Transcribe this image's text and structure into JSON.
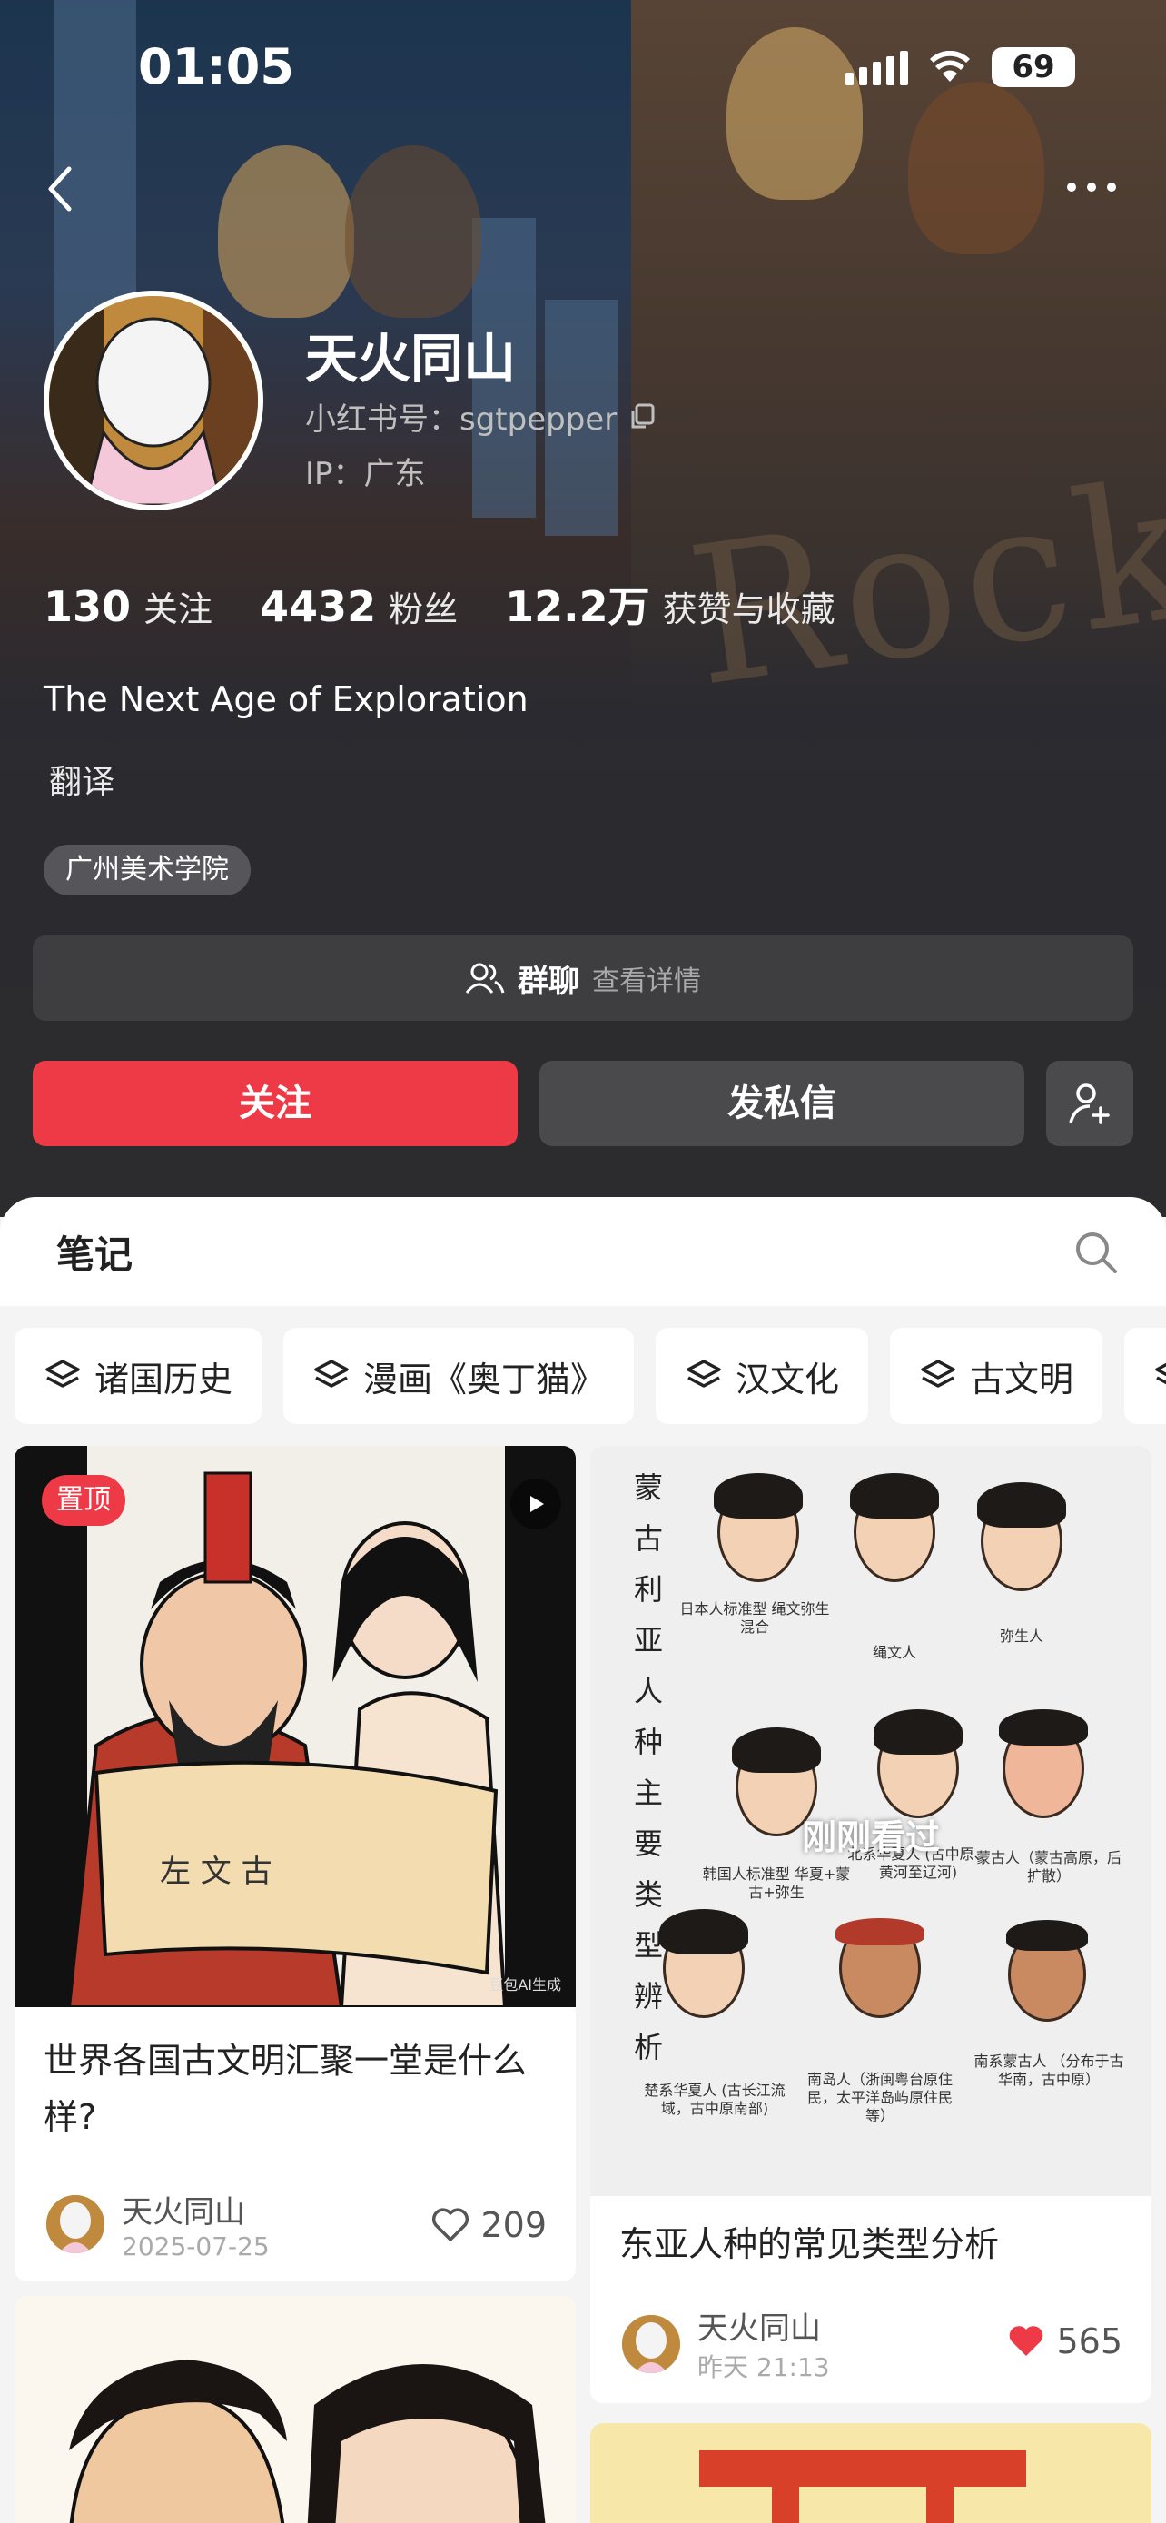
{
  "status_bar": {
    "time": "01:05",
    "battery": "69"
  },
  "profile": {
    "name": "天火同山",
    "red_id": "小红书号：sgtpepper",
    "ip": "IP：广东",
    "stats": [
      {
        "num": "130",
        "label": "关注"
      },
      {
        "num": "4432",
        "label": "粉丝"
      },
      {
        "num": "12.2万",
        "label": "获赞与收藏"
      }
    ],
    "bio": "The Next Age of Exploration",
    "tag": "翻译",
    "school": "广州美术学院",
    "background_text": "Rock"
  },
  "group_chat": {
    "title": "群聊",
    "detail": "查看详情"
  },
  "actions": {
    "follow": "关注",
    "message": "发私信"
  },
  "tabs": {
    "notes": "笔记"
  },
  "collections": [
    "诸国历史",
    "漫画《奥丁猫》",
    "汉文化",
    "古文明"
  ],
  "notes": [
    {
      "pinned_label": "置顶",
      "title": "世界各国古文明汇聚一堂是什么样?",
      "author": "天火同山",
      "date": "2025-07-25",
      "likes": "209",
      "liked": false,
      "watermark": "豆包AI生成"
    },
    {
      "viewed_label": "刚刚看过",
      "cover_title": "蒙古利亚人种主要类型辨析",
      "captions": [
        "日本人标准型 绳文弥生混合",
        "绳文人",
        "弥生人",
        "韩国人标准型 华夏+蒙古+弥生",
        "北系华夏人 (古中原、黄河至辽河)",
        "蒙古人（蒙古高原，后扩散）",
        "楚系华夏人 (古长江流域，古中原南部)",
        "南岛人（浙闽粤台原住民，太平洋岛屿原住民等）",
        "南系蒙古人 （分布于古华南，古中原）"
      ],
      "title": "东亚人种的常见类型分析",
      "author": "天火同山",
      "date": "昨天 21:13",
      "likes": "565",
      "liked": true
    }
  ],
  "colors": {
    "accent": "#ee3a46",
    "dark_bg": "#2c2c2e",
    "button_gray": "#4a4a4c"
  }
}
